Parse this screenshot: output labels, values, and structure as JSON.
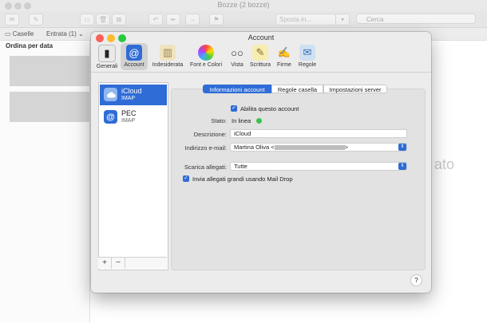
{
  "background_window": {
    "title": "Bozze (2 bozze)",
    "search_placeholder": "Cerca",
    "toolbar_center": "Sposta in...",
    "favbar": {
      "mailboxes": "Caselle",
      "inbox": "Entrata (1)"
    },
    "sort_label": "Ordina per data",
    "right_text": "ato"
  },
  "window": {
    "title": "Account",
    "toolbar": [
      {
        "label": "Generali",
        "icon": "switch-icon"
      },
      {
        "label": "Account",
        "icon": "at-icon"
      },
      {
        "label": "Indesiderata",
        "icon": "trash-icon"
      },
      {
        "label": "Font e Colori",
        "icon": "color-wheel-icon"
      },
      {
        "label": "Vista",
        "icon": "glasses-icon"
      },
      {
        "label": "Scrittura",
        "icon": "pencil-icon"
      },
      {
        "label": "Firme",
        "icon": "signature-icon"
      },
      {
        "label": "Regole",
        "icon": "rules-envelope-icon"
      }
    ],
    "accounts": [
      {
        "name": "iCloud",
        "type": "IMAP"
      },
      {
        "name": "PEC",
        "type": "IMAP"
      }
    ],
    "tabs": [
      "Informazioni account",
      "Regole casella",
      "Impostazioni server"
    ],
    "form": {
      "enable_label": "Abilita questo account",
      "status_label": "Stato:",
      "status_value": "In linea",
      "description_label": "Descrizione:",
      "description_value": "iCloud",
      "email_label": "Indirizzo e-mail:",
      "email_name": "Martina Oliva <",
      "email_close": ">",
      "attachments_label": "Scarica allegati:",
      "attachments_value": "Tutte",
      "maildrop_label": "Invia allegati grandi usando Mail Drop"
    },
    "footer": {
      "add": "+",
      "remove": "−",
      "help": "?"
    }
  },
  "colors": {
    "accent": "#2f6cd6",
    "status_online": "#3cc24a",
    "close": "#fc5f57",
    "minimize": "#fdbc2e",
    "zoom": "#28c840"
  }
}
